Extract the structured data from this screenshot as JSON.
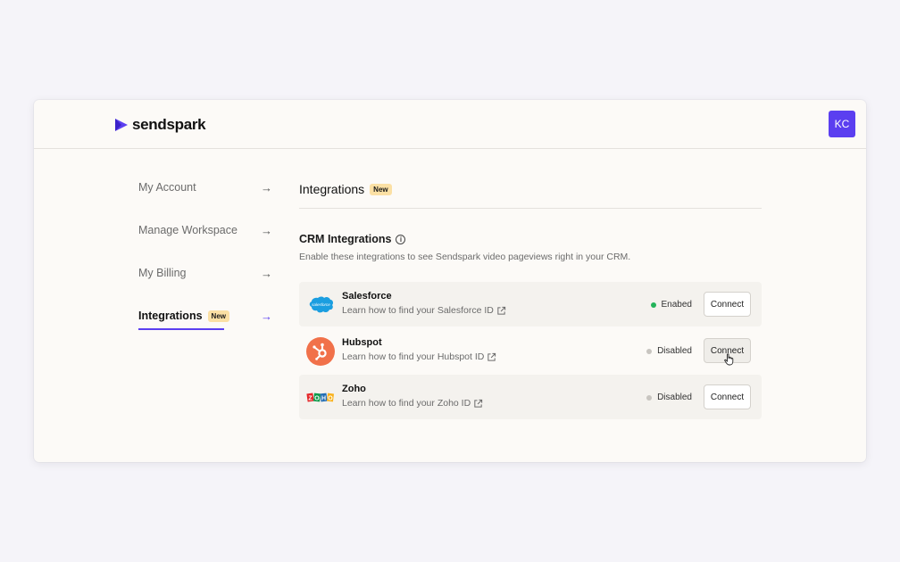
{
  "brand": {
    "name": "sendspark",
    "accent": "#5b3ff0"
  },
  "user": {
    "initials": "KC"
  },
  "sidebar": {
    "items": [
      {
        "label": "My Account",
        "active": false
      },
      {
        "label": "Manage Workspace",
        "active": false
      },
      {
        "label": "My Billing",
        "active": false
      },
      {
        "label": "Integrations",
        "active": true,
        "badge": "New"
      }
    ]
  },
  "page": {
    "title": "Integrations",
    "badge": "New"
  },
  "crm": {
    "title": "CRM Integrations",
    "description": "Enable these integrations to see Sendspark video pageviews right in your CRM.",
    "integrations": [
      {
        "name": "Salesforce",
        "logo_text": "salesforce",
        "link": "Learn how to find your Salesforce ID",
        "status": "Enabed",
        "status_color": "#23b35a",
        "button": "Connect"
      },
      {
        "name": "Hubspot",
        "link": "Learn how to find your Hubspot ID",
        "status": "Disabled",
        "status_color": "#c8c5c0",
        "button": "Connect"
      },
      {
        "name": "Zoho",
        "link": "Learn how to find your Zoho ID",
        "status": "Disabled",
        "status_color": "#c8c5c0",
        "button": "Connect"
      }
    ]
  }
}
